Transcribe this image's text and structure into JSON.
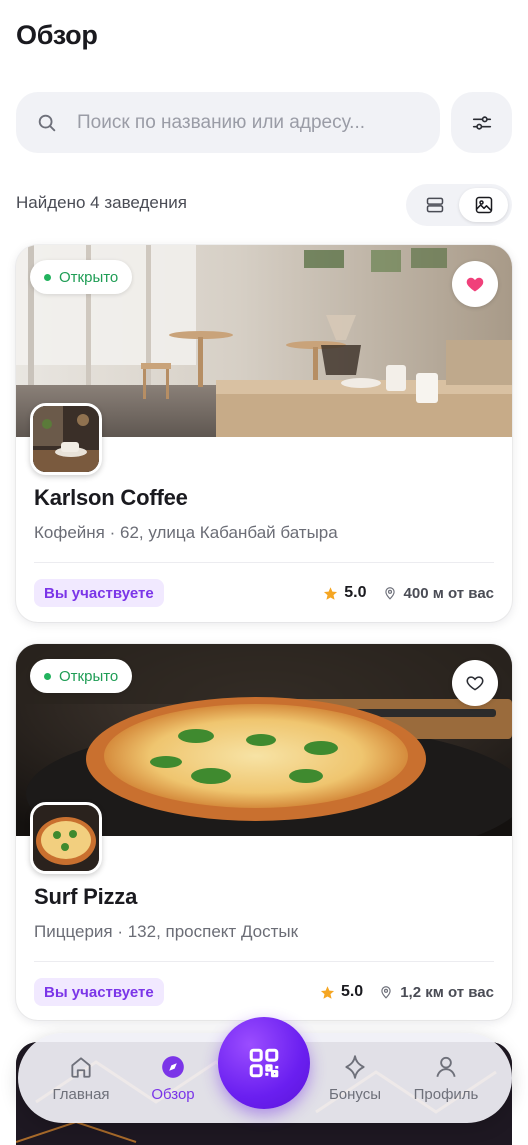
{
  "header": {
    "title": "Обзор"
  },
  "search": {
    "placeholder": "Поиск по названию или адресу..."
  },
  "results": {
    "found_text": "Найдено 4 заведения"
  },
  "colors": {
    "accent": "#7b35e8",
    "open_green": "#1f9d55",
    "favorite_pink": "#f0407a",
    "star": "#f5a623"
  },
  "venues": [
    {
      "status": "Открыто",
      "favorite": true,
      "name": "Karlson Coffee",
      "meta": "Кофейня · 62, улица Кабанбай батыра",
      "badge": "Вы участвуете",
      "rating": "5.0",
      "distance": "400 м от вас"
    },
    {
      "status": "Открыто",
      "favorite": false,
      "name": "Surf Pizza",
      "meta": "Пиццерия · 132, проспект Достык",
      "badge": "Вы участвуете",
      "rating": "5.0",
      "distance": "1,2 км от вас"
    }
  ],
  "nav": {
    "items": [
      {
        "label": "Главная",
        "icon": "home-icon"
      },
      {
        "label": "Обзор",
        "icon": "compass-icon",
        "active": true
      },
      {
        "label": "Бонусы",
        "icon": "sparkle-icon"
      },
      {
        "label": "Профиль",
        "icon": "profile-icon"
      }
    ],
    "center_icon": "qr-code-icon"
  }
}
